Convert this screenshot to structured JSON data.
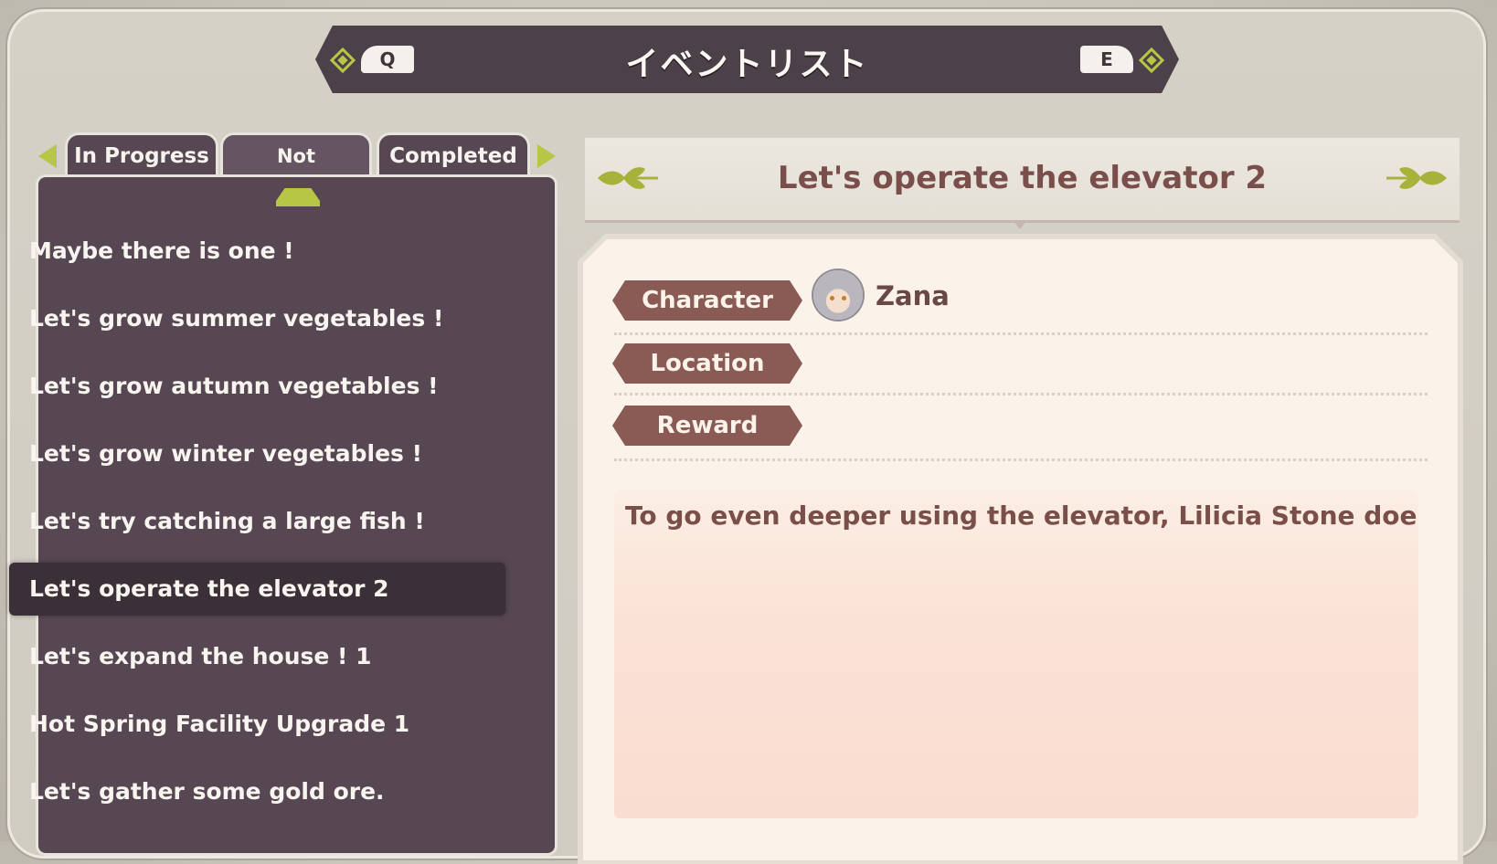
{
  "header": {
    "title": "イベントリスト",
    "prev_key": "Q",
    "next_key": "E"
  },
  "tabs": [
    {
      "label": "In Progress"
    },
    {
      "label": "Not Triggered"
    },
    {
      "label": "Completed"
    }
  ],
  "active_tab": "Not Triggered",
  "event_list": [
    {
      "label": "Maybe there is one !"
    },
    {
      "label": "Let's grow summer vegetables !"
    },
    {
      "label": "Let's grow autumn vegetables !"
    },
    {
      "label": "Let's grow winter vegetables !"
    },
    {
      "label": "Let's try catching a large fish !"
    },
    {
      "label": "Let's operate the elevator 2"
    },
    {
      "label": "Let's expand the house !  1"
    },
    {
      "label": "Hot Spring Facility Upgrade 1"
    },
    {
      "label": "Let's gather some gold ore."
    }
  ],
  "selected_event": "Let's operate the elevator 2",
  "detail": {
    "title": "Let's operate the elevator 2",
    "character_label": "Character",
    "character_name": "Zana",
    "location_label": "Location",
    "reward_label": "Reward",
    "description": "To go even deeper using the elevator, Lilicia Stone doesn't s"
  },
  "colors": {
    "panel": "#574752",
    "accent": "#b7c644",
    "badge": "#8a5b55",
    "title_text": "#7a4e4a",
    "card": "#fbf3ea"
  }
}
